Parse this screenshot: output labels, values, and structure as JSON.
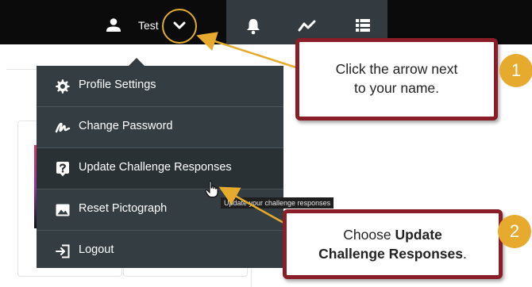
{
  "topbar": {
    "user_name": "Test",
    "icons": [
      "user-icon",
      "chevron-down-icon",
      "bell-icon",
      "trend-icon",
      "list-icon"
    ]
  },
  "menu": {
    "items": [
      {
        "label": "Profile Settings",
        "icon": "gear-icon"
      },
      {
        "label": "Change Password",
        "icon": "signature-icon"
      },
      {
        "label": "Update Challenge Responses",
        "icon": "question-icon"
      },
      {
        "label": "Reset Pictograph",
        "icon": "image-icon"
      },
      {
        "label": "Logout",
        "icon": "logout-icon"
      }
    ]
  },
  "tooltip": "Update your challenge responses",
  "callouts": {
    "step1": {
      "number": "1",
      "line1": "Click the arrow next",
      "line2": "to your name."
    },
    "step2": {
      "number": "2",
      "prefix": "Choose ",
      "bold1": "Update",
      "bold2": "Challenge Responses",
      "suffix": "."
    }
  },
  "colors": {
    "accent": "#e6ab2e",
    "callout_border": "#8a1e28",
    "menu_bg": "#343d41",
    "topbar": "#0b0b0b"
  }
}
